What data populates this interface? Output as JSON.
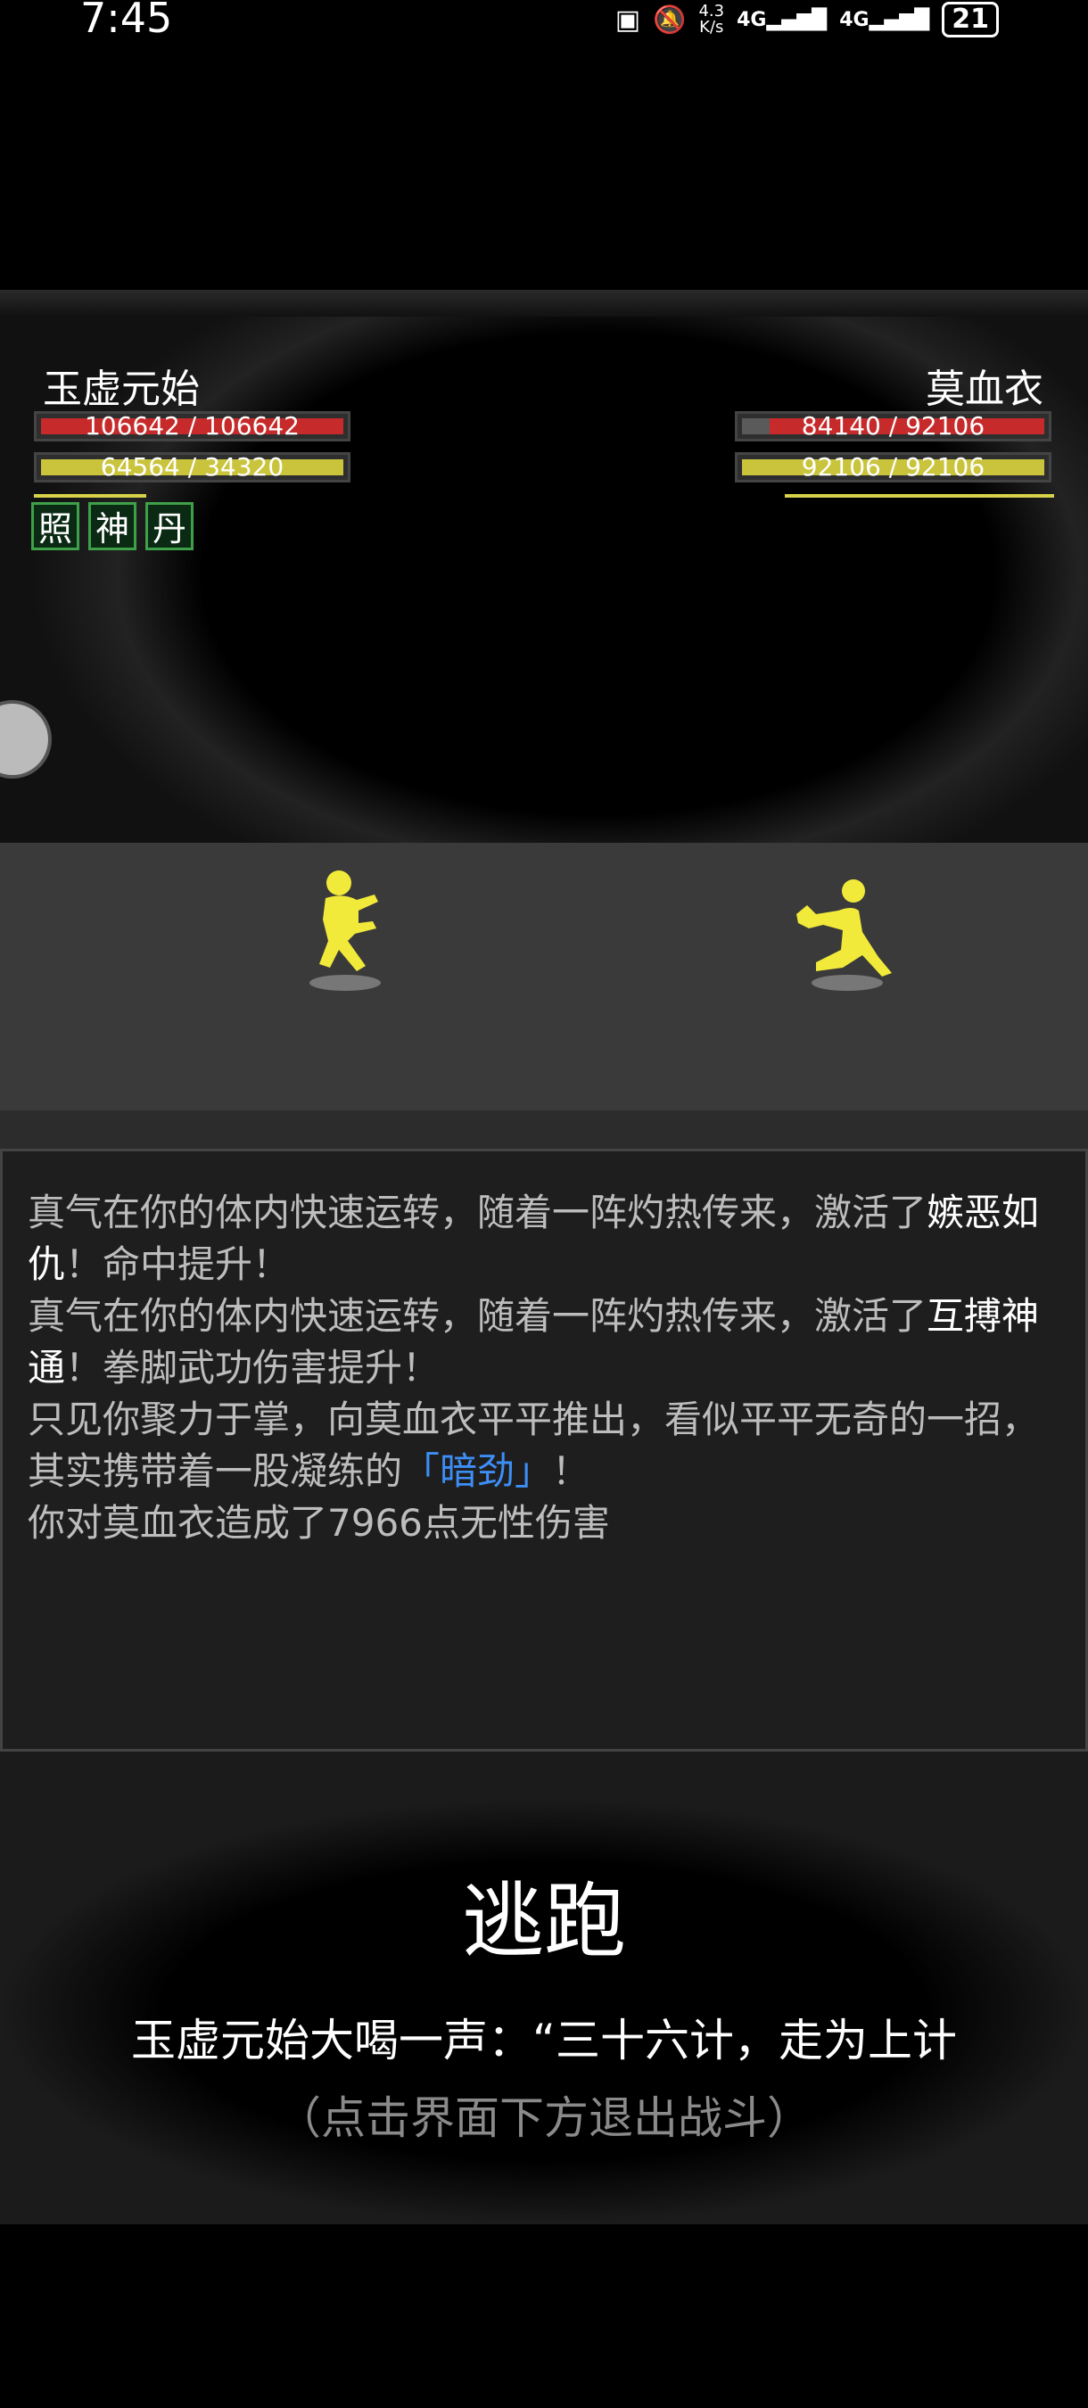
{
  "status_bar": {
    "time": "7:45",
    "speed_top": "4.3",
    "speed_unit": "K/s",
    "net1": "4G",
    "net2": "4G",
    "battery": "21"
  },
  "player": {
    "name": "玉虚元始",
    "hp_text": "106642 / 106642",
    "hp_fraction": 1.0,
    "mp_text": "64564 / 34320",
    "mp_fraction": 1.0,
    "buffs": [
      "照",
      "神",
      "丹"
    ]
  },
  "enemy": {
    "name": "莫血衣",
    "hp_text": "84140 / 92106",
    "hp_fraction": 0.91,
    "mp_text": "92106 / 92106",
    "mp_fraction": 1.0
  },
  "log": {
    "line1_a": "真气在你的体内快速运转，随着一阵灼热传来，激活了",
    "line1_em": "嫉恶如仇",
    "line1_b": "！命中提升！",
    "line2_a": "真气在你的体内快速运转，随着一阵灼热传来，激活了",
    "line2_em": "互搏神通",
    "line2_b": "！拳脚武功伤害提升！",
    "line3_a": "只见你聚力于掌，向莫血衣平平推出，看似平平无奇的一招，其实携带着一股凝练的",
    "line3_blue": "「暗劲」",
    "line3_b": "！",
    "line4": "你对莫血衣造成了7966点无性伤害"
  },
  "escape": {
    "title": "逃跑",
    "message": "玉虚元始大喝一声：“三十六计，走为上计",
    "hint": "（点击界面下方退出战斗）"
  },
  "colors": {
    "hp": "#c62a2a",
    "mp": "#c9c43c",
    "buff_border": "#3fa04a",
    "highlight_blue": "#3d8ef5",
    "fighter": "#f2ea3a"
  }
}
